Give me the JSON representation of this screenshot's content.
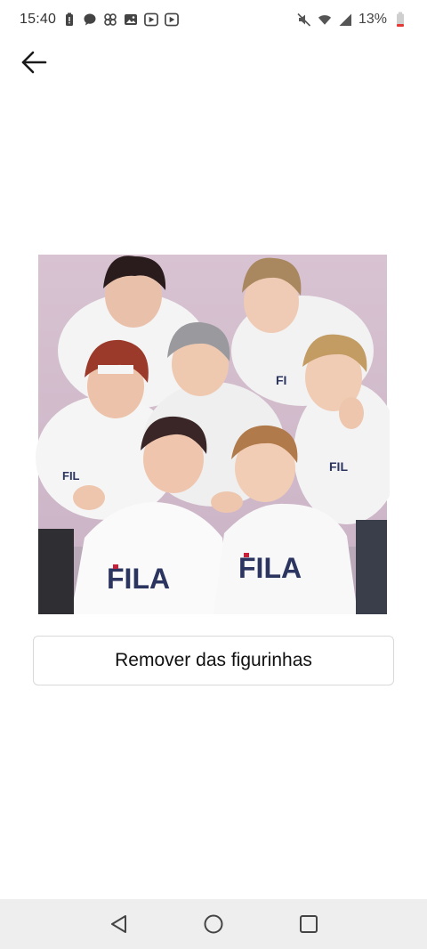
{
  "status_bar": {
    "time": "15:40",
    "battery_percent": "13%",
    "notification_icons": [
      "battery-alert-icon",
      "chat-bubble-icon",
      "pinwheel-icon",
      "gallery-icon",
      "media-play-icon",
      "media-play-icon"
    ],
    "system_icons": [
      "mute-icon",
      "wifi-icon",
      "signal-icon",
      "battery-low-icon"
    ]
  },
  "header": {
    "back_icon": "arrow-left-icon"
  },
  "sticker": {
    "description_visible_text": "FILA"
  },
  "actions": {
    "remove_label": "Remover das figurinhas"
  },
  "nav_bar": {
    "back": "triangle-back-icon",
    "home": "circle-home-icon",
    "recents": "square-recents-icon"
  },
  "colors": {
    "background": "#ffffff",
    "button_border": "#d9d9d9",
    "nav_background": "#eeeeee",
    "photo_backdrop": "#d8bfcf",
    "fila_navy": "#2b3560",
    "fila_red": "#c8203b",
    "battery_red": "#e53935"
  }
}
